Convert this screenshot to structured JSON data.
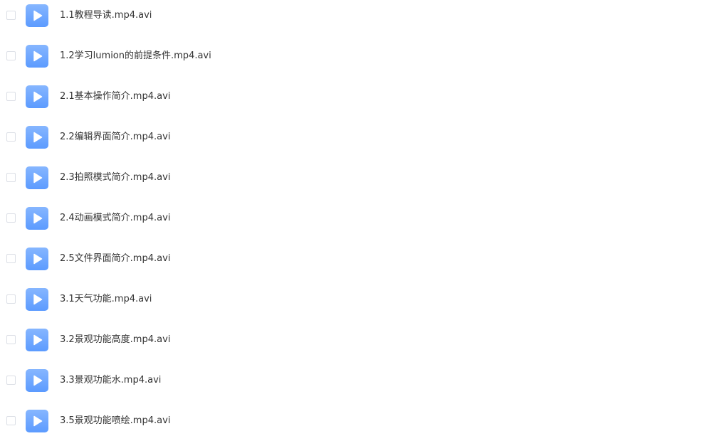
{
  "files": [
    {
      "name": "1.1教程导读.mp4.avi",
      "icon": "play-icon"
    },
    {
      "name": "1.2学习lumion的前提条件.mp4.avi",
      "icon": "play-icon"
    },
    {
      "name": "2.1基本操作简介.mp4.avi",
      "icon": "play-icon"
    },
    {
      "name": "2.2编辑界面简介.mp4.avi",
      "icon": "play-icon"
    },
    {
      "name": "2.3拍照模式简介.mp4.avi",
      "icon": "play-icon"
    },
    {
      "name": "2.4动画模式简介.mp4.avi",
      "icon": "play-icon"
    },
    {
      "name": "2.5文件界面简介.mp4.avi",
      "icon": "play-icon"
    },
    {
      "name": "3.1天气功能.mp4.avi",
      "icon": "play-icon"
    },
    {
      "name": "3.2景观功能高度.mp4.avi",
      "icon": "play-icon"
    },
    {
      "name": "3.3景观功能水.mp4.avi",
      "icon": "play-icon"
    },
    {
      "name": "3.5景观功能喷绘.mp4.avi",
      "icon": "play-icon"
    }
  ],
  "colors": {
    "icon_gradient_top": "#86b6ff",
    "icon_gradient_bottom": "#5c9bff",
    "text": "#333333",
    "checkbox_border": "#dcdfe6"
  }
}
